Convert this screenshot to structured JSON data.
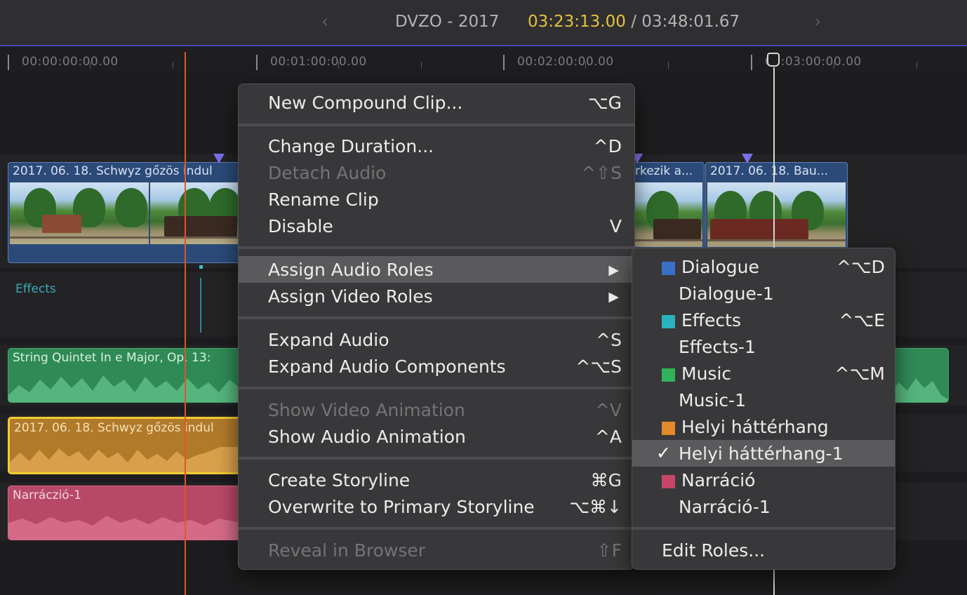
{
  "header": {
    "prev_icon": "‹",
    "next_icon": "›",
    "project_title": "DVZO - 2017",
    "current_timecode": "03:23:13.00",
    "separator": "/",
    "total_timecode": "03:48:01.67"
  },
  "ruler": {
    "labels": [
      "00:00:00:00.00",
      "00:01:00:00.00",
      "00:02:00:00.00",
      "00:03:00:00.00"
    ]
  },
  "timeline": {
    "video_clips": [
      {
        "title": "2017. 06. 18. Schwyz gőzös indul"
      },
      {
        "title": "rkezik a..."
      },
      {
        "title": "2017. 06. 18. Bau..."
      }
    ],
    "effects_lane_label": "Effects",
    "audio_clips": {
      "music": "String Quintet In e Major, Op. 13:",
      "local": "2017. 06. 18. Schwyz gőzös indul",
      "narration": "Narráczió-1"
    },
    "colors": {
      "playhead": "#e0552a",
      "selection": "#f0cc32",
      "music": "#2f8a55",
      "local": "#b07a2a",
      "narration": "#b84868",
      "video": "#2b4a78"
    }
  },
  "context_menu": {
    "new_compound": {
      "label": "New Compound Clip...",
      "shortcut": "⌥G"
    },
    "change_duration": {
      "label": "Change Duration...",
      "shortcut": "^D"
    },
    "detach_audio": {
      "label": "Detach Audio",
      "shortcut": "^⇧S"
    },
    "rename_clip": {
      "label": "Rename Clip",
      "shortcut": ""
    },
    "disable": {
      "label": "Disable",
      "shortcut": "V"
    },
    "assign_audio_roles": {
      "label": "Assign Audio Roles",
      "arrow": "▶"
    },
    "assign_video_roles": {
      "label": "Assign Video Roles",
      "arrow": "▶"
    },
    "expand_audio": {
      "label": "Expand Audio",
      "shortcut": "^S"
    },
    "expand_audio_components": {
      "label": "Expand Audio Components",
      "shortcut": "^⌥S"
    },
    "show_video_animation": {
      "label": "Show Video Animation",
      "shortcut": "^V"
    },
    "show_audio_animation": {
      "label": "Show Audio Animation",
      "shortcut": "^A"
    },
    "create_storyline": {
      "label": "Create Storyline",
      "shortcut": "⌘G"
    },
    "overwrite_primary": {
      "label": "Overwrite to Primary Storyline",
      "shortcut": "⌥⌘↓"
    },
    "reveal_in_browser": {
      "label": "Reveal in Browser",
      "shortcut": "⇧F"
    }
  },
  "roles_submenu": {
    "dialogue": {
      "label": "Dialogue",
      "shortcut": "^⌥D",
      "color": "#3a6fc8"
    },
    "dialogue_1": {
      "label": "Dialogue-1"
    },
    "effects": {
      "label": "Effects",
      "shortcut": "^⌥E",
      "color": "#2ab3bf"
    },
    "effects_1": {
      "label": "Effects-1"
    },
    "music": {
      "label": "Music",
      "shortcut": "^⌥M",
      "color": "#2fb35a"
    },
    "music_1": {
      "label": "Music-1"
    },
    "helyi": {
      "label": "Helyi háttérhang",
      "color": "#e38a2a"
    },
    "helyi_1": {
      "label": "Helyi háttérhang-1",
      "check": "✓"
    },
    "narracio": {
      "label": "Narráció",
      "color": "#c8456a"
    },
    "narracio_1": {
      "label": "Narráció-1"
    },
    "edit_roles": {
      "label": "Edit Roles..."
    }
  }
}
